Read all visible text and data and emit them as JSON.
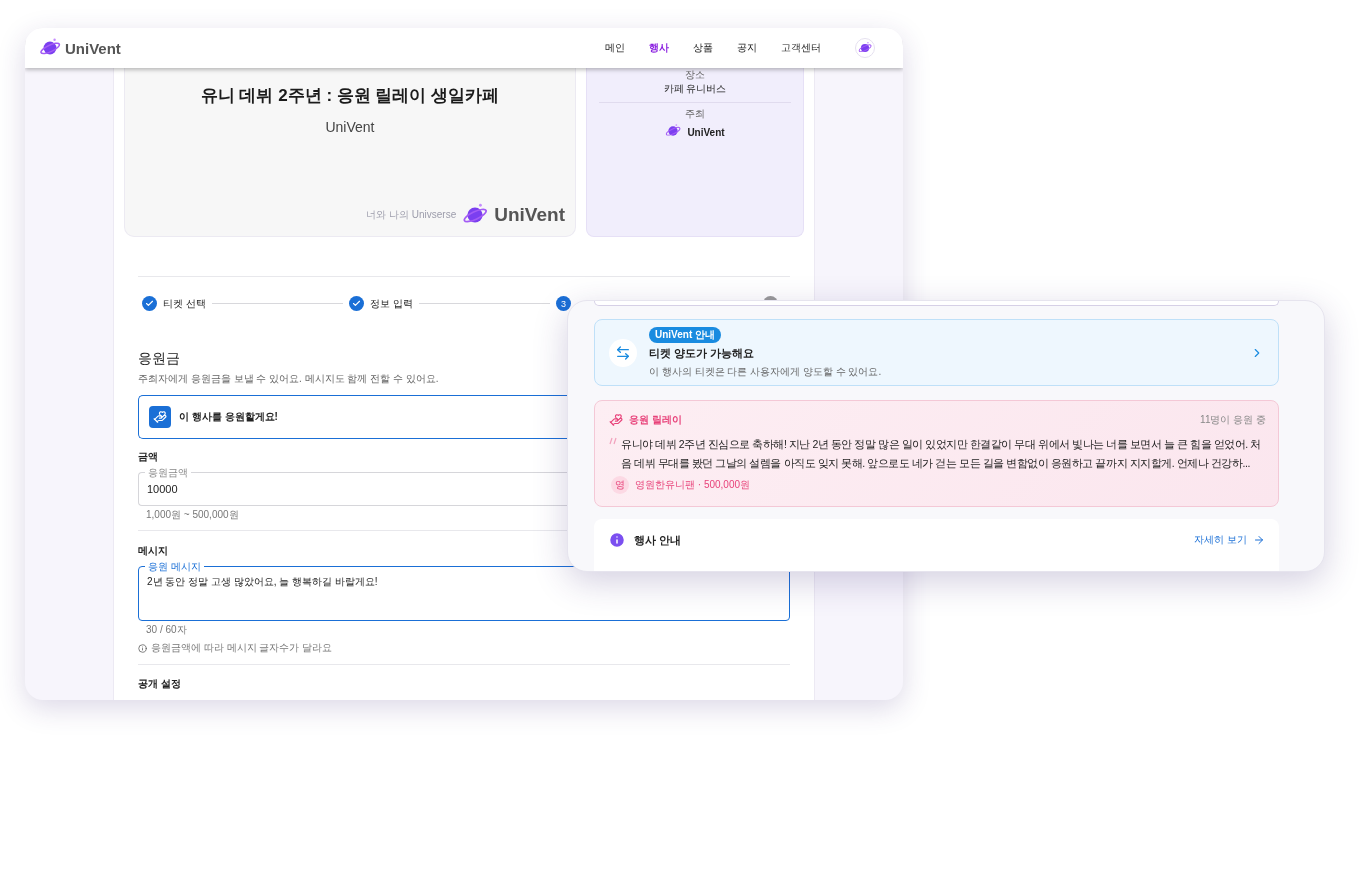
{
  "back_window": {
    "nav": {
      "logo": "UniVent",
      "items": [
        {
          "label": "메인",
          "selected": false
        },
        {
          "label": "행사",
          "selected": true
        },
        {
          "label": "상품",
          "selected": false
        },
        {
          "label": "공지",
          "selected": false
        },
        {
          "label": "고객센터",
          "selected": false
        }
      ]
    },
    "event_banner": {
      "title": "유니 데뷔 2주년 : 응원 릴레이 생일카페",
      "subtitle": "UniVent",
      "tagline": "너와 나의 Univserse",
      "brand": "UniVent"
    },
    "info_card": {
      "fields": [
        {
          "kind": "text",
          "label": "장소",
          "value": "카페 유니버스"
        },
        {
          "kind": "host",
          "label": "주최",
          "value": "UniVent"
        }
      ]
    },
    "stepper": [
      {
        "kind": "done",
        "label": "티켓 선택"
      },
      {
        "kind": "done",
        "label": "정보 입력"
      },
      {
        "kind": "current",
        "number": "3"
      },
      {
        "kind": "pending"
      }
    ],
    "support": {
      "title": "응원금",
      "description": "주최자에게 응원금을 보낼 수 있어요. 메시지도 함께 전할 수 있어요.",
      "option": "이 행사를 응원할게요!",
      "amount_label": "금액",
      "amount_field": {
        "label": "응원금액",
        "value": "10000",
        "hint": "1,000원 ~ 500,000원"
      },
      "message_label": "메시지",
      "message_field": {
        "label": "응원 메시지",
        "value": "2년 동안 정말 고생 많았어요, 늘 행복하길 바랄게요!",
        "counter": "30 / 60자",
        "note": "응원금액에 따라 메시지 글자수가 달라요"
      },
      "visibility_label": "공개 설정"
    }
  },
  "front_window": {
    "transfer_notice": {
      "badge": "UniVent 안내",
      "title": "티켓 양도가 가능해요",
      "description": "이 행사의 티켓은 다른 사용자에게 양도할 수 있어요."
    },
    "relay": {
      "title": "응원 릴레이",
      "count": "11명이 응원 중",
      "message": "유니야 데뷔 2주년 진심으로 축하해! 지난 2년 동안 정말 많은 일이 있었지만 한결같이 무대 위에서 빛나는 너를 보면서 늘 큰 힘을 얻었어. 처음 데뷔 무대를 봤던 그날의 설렘을 아직도 잊지 못해. 앞으로도 네가 걷는 모든 길을 변함없이 응원하고 끝까지 지지할게. 언제나 건강하...",
      "avatar": "영",
      "author": "영원한유니팬 · 500,000원"
    },
    "event_info": {
      "title": "행사 안내",
      "link": "자세히 보기"
    }
  }
}
